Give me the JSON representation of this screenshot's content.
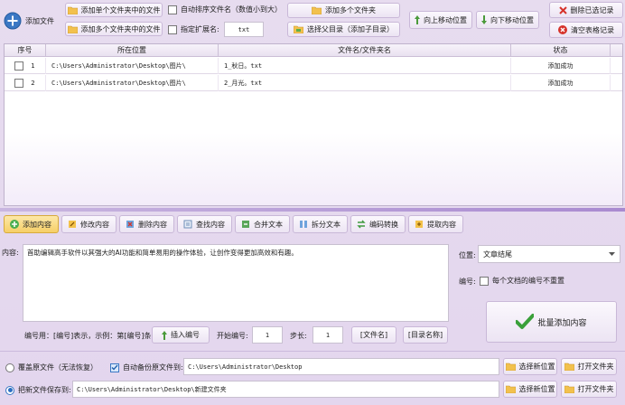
{
  "toolbar": {
    "add_file": "添加文件",
    "add_single_folder_files": "添加单个文件夹中的文件",
    "add_multi_folder_files": "添加多个文件夹中的文件",
    "auto_sort": "自动排序文件名（数值小到大）",
    "specify_ext": "指定扩展名:",
    "ext_value": "txt",
    "add_multi_folders": "添加多个文件夹",
    "select_parent_dir": "选择父目录（添加子目录）",
    "move_up": "向上移动位置",
    "move_down": "向下移动位置",
    "delete_selected": "删除已选记录",
    "clear_table": "清空表格记录"
  },
  "table": {
    "headers": [
      "序号",
      "所在位置",
      "文件名/文件夹名",
      "状态"
    ],
    "rows": [
      {
        "index": "1",
        "location": "C:\\Users\\Administrator\\Desktop\\图片\\",
        "name": "1_秋日。txt",
        "status": "添加成功"
      },
      {
        "index": "2",
        "location": "C:\\Users\\Administrator\\Desktop\\图片\\",
        "name": "2_月光。txt",
        "status": "添加成功"
      }
    ]
  },
  "tabs": [
    "添加内容",
    "修改内容",
    "删除内容",
    "查找内容",
    "合并文本",
    "拆分文本",
    "编码转换",
    "提取内容"
  ],
  "content": {
    "label": "内容:",
    "text": "首助编辑高手软件以其强大的AI功能和简单易用的操作体验，让创作变得更加高效和有趣。",
    "position_label": "位置:",
    "position_value": "文章结尾",
    "numbering_label": "编号:",
    "numbering_option": "每个文档的编号不重置",
    "numbering_hint": "编号用：[编号]表示，示例：第[编号]条",
    "insert_number": "插入编号",
    "start_label": "开始编号:",
    "start_value": "1",
    "step_label": "步长:",
    "step_value": "1",
    "filename_tag": "[文件名]",
    "dirname_tag": "[目录名称]",
    "batch_add": "批量添加内容"
  },
  "output": {
    "overwrite_label": "覆盖原文件（无法恢复）",
    "backup_label": "自动备份原文件到:",
    "backup_path": "C:\\Users\\Administrator\\Desktop",
    "saveto_label": "把新文件保存到:",
    "saveto_path": "C:\\Users\\Administrator\\Desktop\\新建文件夹",
    "choose_location": "选择新位置",
    "open_folder": "打开文件夹"
  }
}
